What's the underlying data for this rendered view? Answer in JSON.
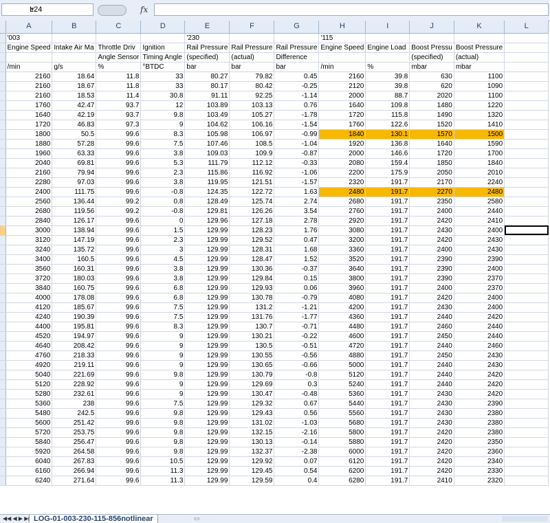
{
  "formula_bar": {
    "name_box": "L24",
    "fx": "fx",
    "formula": ""
  },
  "columns": [
    "A",
    "B",
    "C",
    "D",
    "E",
    "F",
    "G",
    "H",
    "I",
    "J",
    "K",
    "L"
  ],
  "header_rows": [
    [
      "'003",
      "",
      "",
      "",
      "'230",
      "",
      "",
      "'115",
      "",
      "",
      "",
      ""
    ],
    [
      "Engine Speed",
      "Intake Air Ma",
      "Throttle Driv",
      "Ignition",
      "Rail Pressure",
      "Rail Pressure",
      "Rail Pressure",
      "Engine Speed",
      "Engine Load",
      "Boost Pressu",
      "Boost Pressure",
      ""
    ],
    [
      "",
      "",
      "Angle Sensor",
      "Timing Angle",
      "(specified)",
      "(actual)",
      "Difference",
      "",
      "",
      "(specified)",
      "(actual)",
      ""
    ],
    [
      "/min",
      "g/s",
      "%",
      "°BTDC",
      "bar",
      "bar",
      "bar",
      "/min",
      "%",
      "mbar",
      "mbar",
      ""
    ]
  ],
  "data_rows": [
    [
      "2160",
      "18.64",
      "11.8",
      "33",
      "80.27",
      "79.82",
      "0.45",
      "2160",
      "39.8",
      "630",
      "1100"
    ],
    [
      "2160",
      "18.67",
      "11.8",
      "33",
      "80.17",
      "80.42",
      "-0.25",
      "2120",
      "39.8",
      "620",
      "1090"
    ],
    [
      "2160",
      "18.53",
      "11.4",
      "30.8",
      "91.11",
      "92.25",
      "-1.14",
      "2000",
      "88.7",
      "2020",
      "1100"
    ],
    [
      "1760",
      "42.47",
      "93.7",
      "12",
      "103.89",
      "103.13",
      "0.76",
      "1640",
      "109.8",
      "1480",
      "1220"
    ],
    [
      "1640",
      "42.19",
      "93.7",
      "9.8",
      "103.49",
      "105.27",
      "-1.78",
      "1720",
      "115.8",
      "1490",
      "1320"
    ],
    [
      "1720",
      "46.83",
      "97.3",
      "9",
      "104.62",
      "106.16",
      "-1.54",
      "1760",
      "122.6",
      "1520",
      "1410"
    ],
    [
      "1800",
      "50.5",
      "99.6",
      "8.3",
      "105.98",
      "106.97",
      "-0.99",
      "1840",
      "130.1",
      "1570",
      "1500"
    ],
    [
      "1880",
      "57.28",
      "99.6",
      "7.5",
      "107.46",
      "108.5",
      "-1.04",
      "1920",
      "136.8",
      "1640",
      "1590"
    ],
    [
      "1960",
      "63.33",
      "99.6",
      "3.8",
      "109.03",
      "109.9",
      "-0.87",
      "2000",
      "146.6",
      "1720",
      "1700"
    ],
    [
      "2040",
      "69.81",
      "99.6",
      "5.3",
      "111.79",
      "112.12",
      "-0.33",
      "2080",
      "159.4",
      "1850",
      "1840"
    ],
    [
      "2160",
      "79.94",
      "99.6",
      "2.3",
      "115.86",
      "116.92",
      "-1.06",
      "2200",
      "175.9",
      "2050",
      "2010"
    ],
    [
      "2280",
      "97.03",
      "99.6",
      "3.8",
      "119.95",
      "121.51",
      "-1.57",
      "2320",
      "191.7",
      "2170",
      "2240"
    ],
    [
      "2400",
      "111.75",
      "99.6",
      "-0.8",
      "124.35",
      "122.72",
      "1.63",
      "2480",
      "191.7",
      "2270",
      "2480"
    ],
    [
      "2560",
      "136.44",
      "99.2",
      "0.8",
      "128.49",
      "125.74",
      "2.74",
      "2680",
      "191.7",
      "2350",
      "2580"
    ],
    [
      "2680",
      "119.56",
      "99.2",
      "-0.8",
      "129.81",
      "126.26",
      "3.54",
      "2760",
      "191.7",
      "2400",
      "2440"
    ],
    [
      "2840",
      "126.17",
      "99.6",
      "0",
      "129.96",
      "127.18",
      "2.78",
      "2920",
      "191.7",
      "2420",
      "2410"
    ],
    [
      "3000",
      "138.94",
      "99.6",
      "1.5",
      "129.99",
      "128.23",
      "1.76",
      "3080",
      "191.7",
      "2430",
      "2400"
    ],
    [
      "3120",
      "147.19",
      "99.6",
      "2.3",
      "129.99",
      "129.52",
      "0.47",
      "3200",
      "191.7",
      "2420",
      "2430"
    ],
    [
      "3240",
      "135.72",
      "99.6",
      "3",
      "129.99",
      "128.31",
      "1.68",
      "3360",
      "191.7",
      "2400",
      "2430"
    ],
    [
      "3400",
      "160.5",
      "99.6",
      "4.5",
      "129.99",
      "128.47",
      "1.52",
      "3520",
      "191.7",
      "2390",
      "2390"
    ],
    [
      "3560",
      "160.31",
      "99.6",
      "3.8",
      "129.99",
      "130.36",
      "-0.37",
      "3640",
      "191.7",
      "2390",
      "2400"
    ],
    [
      "3720",
      "180.03",
      "99.6",
      "3.8",
      "129.99",
      "129.84",
      "0.15",
      "3800",
      "191.7",
      "2390",
      "2370"
    ],
    [
      "3840",
      "160.75",
      "99.6",
      "6.8",
      "129.99",
      "129.93",
      "0.06",
      "3960",
      "191.7",
      "2400",
      "2370"
    ],
    [
      "4000",
      "178.08",
      "99.6",
      "6.8",
      "129.99",
      "130.78",
      "-0.79",
      "4080",
      "191.7",
      "2420",
      "2400"
    ],
    [
      "4120",
      "185.67",
      "99.6",
      "7.5",
      "129.99",
      "131.2",
      "-1.21",
      "4200",
      "191.7",
      "2430",
      "2400"
    ],
    [
      "4240",
      "190.39",
      "99.6",
      "7.5",
      "129.99",
      "131.76",
      "-1.77",
      "4360",
      "191.7",
      "2440",
      "2420"
    ],
    [
      "4400",
      "195.81",
      "99.6",
      "8.3",
      "129.99",
      "130.7",
      "-0.71",
      "4480",
      "191.7",
      "2460",
      "2440"
    ],
    [
      "4520",
      "194.97",
      "99.6",
      "9",
      "129.99",
      "130.21",
      "-0.22",
      "4600",
      "191.7",
      "2450",
      "2440"
    ],
    [
      "4640",
      "208.42",
      "99.6",
      "9",
      "129.99",
      "130.5",
      "-0.51",
      "4720",
      "191.7",
      "2440",
      "2460"
    ],
    [
      "4760",
      "218.33",
      "99.6",
      "9",
      "129.99",
      "130.55",
      "-0.56",
      "4880",
      "191.7",
      "2450",
      "2430"
    ],
    [
      "4920",
      "219.11",
      "99.6",
      "9",
      "129.99",
      "130.65",
      "-0.66",
      "5000",
      "191.7",
      "2440",
      "2430"
    ],
    [
      "5040",
      "221.69",
      "99.6",
      "9.8",
      "129.99",
      "130.79",
      "-0.8",
      "5120",
      "191.7",
      "2440",
      "2420"
    ],
    [
      "5120",
      "228.92",
      "99.6",
      "9",
      "129.99",
      "129.69",
      "0.3",
      "5240",
      "191.7",
      "2440",
      "2420"
    ],
    [
      "5280",
      "232.61",
      "99.6",
      "9",
      "129.99",
      "130.47",
      "-0.48",
      "5360",
      "191.7",
      "2430",
      "2420"
    ],
    [
      "5360",
      "238",
      "99.6",
      "7.5",
      "129.99",
      "129.32",
      "0.67",
      "5440",
      "191.7",
      "2430",
      "2390"
    ],
    [
      "5480",
      "242.5",
      "99.6",
      "9.8",
      "129.99",
      "129.43",
      "0.56",
      "5560",
      "191.7",
      "2430",
      "2380"
    ],
    [
      "5600",
      "251.42",
      "99.6",
      "9.8",
      "129.99",
      "131.02",
      "-1.03",
      "5680",
      "191.7",
      "2430",
      "2380"
    ],
    [
      "5720",
      "253.75",
      "99.6",
      "9.8",
      "129.99",
      "132.15",
      "-2.16",
      "5800",
      "191.7",
      "2420",
      "2380"
    ],
    [
      "5840",
      "256.47",
      "99.6",
      "9.8",
      "129.99",
      "130.13",
      "-0.14",
      "5880",
      "191.7",
      "2420",
      "2350"
    ],
    [
      "5920",
      "264.58",
      "99.6",
      "9.8",
      "129.99",
      "132.37",
      "-2.38",
      "6000",
      "191.7",
      "2420",
      "2360"
    ],
    [
      "6040",
      "267.83",
      "99.6",
      "10.5",
      "129.99",
      "129.92",
      "0.07",
      "6120",
      "191.7",
      "2420",
      "2340"
    ],
    [
      "6160",
      "266.94",
      "99.6",
      "11.3",
      "129.99",
      "129.45",
      "0.54",
      "6200",
      "191.7",
      "2420",
      "2330"
    ],
    [
      "6240",
      "271.64",
      "99.6",
      "11.3",
      "129.99",
      "129.59",
      "0.4",
      "6280",
      "191.7",
      "2410",
      "2320"
    ]
  ],
  "highlight_color": "#f9b800",
  "sheet_tab": "LOG-01-003-230-115-856notlinear"
}
